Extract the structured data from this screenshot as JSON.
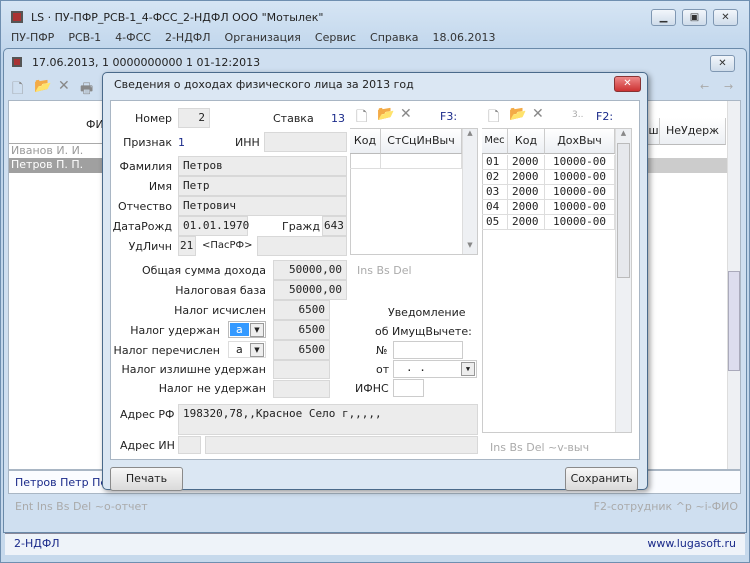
{
  "app": {
    "title": "LS · ПУ-ПФР_РСВ-1_4-ФСС_2-НДФЛ   ООО \"Мотылек\"",
    "menu": [
      "ПУ-ПФР",
      "РСВ-1",
      "4-ФСС",
      "2-НДФЛ",
      "Организация",
      "Сервис",
      "Справка",
      "18.06.2013"
    ]
  },
  "mdi": {
    "title": "17.06.2013, 1  0000000000  1  01-12:2013",
    "grid_header_fio": "ФИ",
    "columns_right": [
      "ш",
      "НеУдерж"
    ],
    "rows": [
      "Иванов И. И.",
      "Петров П. П."
    ],
    "footer_name": "Петров Петр Пе",
    "status_left": "Ent  Ins Bs Del  ~o-отчет",
    "status_right": "F2-сотрудник   ^p  ~i-ФИО",
    "bottom_left": "2-НДФЛ",
    "bottom_right": "www.lugasoft.ru"
  },
  "dialog": {
    "title": "Сведения о доходах физического лица за 2013 год",
    "nomer_label": "Номер",
    "nomer": "2",
    "stavka_label": "Ставка",
    "stavka": "13",
    "priznak_label": "Признак",
    "priznak": "1",
    "inn_label": "ИНН",
    "inn": "",
    "familia_label": "Фамилия",
    "familia": "Петров",
    "imya_label": "Имя",
    "imya": "Петр",
    "otchestvo_label": "Отчество",
    "otchestvo": "Петрович",
    "dob_label": "ДатаРожд",
    "dob": "01.01.1970",
    "grazhd_label": "Гражд",
    "grazhd": "643",
    "udl_label": "УдЛичн",
    "udl": "21",
    "udl_type": "<ПасРФ>",
    "udl_num": "",
    "total_label": "Общая сумма дохода",
    "total": "50000,00",
    "hint1": "Ins Bs Del",
    "base_label": "Налоговая база",
    "base": "50000,00",
    "calc_label": "Налог исчислен",
    "calc": "6500",
    "held_label": "Налог удержан",
    "held_code": "a",
    "held": "6500",
    "paid_label": "Налог перечислен",
    "paid_code": "a",
    "paid": "6500",
    "over_label": "Налог излишне удержан",
    "over": "",
    "notheld_label": "Налог не удержан",
    "notheld": "",
    "notice_label1": "Уведомление",
    "notice_label2": "об ИмущВычете:",
    "num_label": "№",
    "num": "",
    "from_label": "от",
    "from": " .  . ",
    "ifns_label": "ИФНС",
    "ifns": "",
    "addr_rf_label": "Адрес РФ",
    "addr_rf": "198320,78,,Красное Село г,,,,,",
    "addr_in_label": "Адрес ИН",
    "f3": "F3:",
    "f2": "F2:",
    "f2_more": "3..",
    "ded_table": {
      "columns": [
        "Код",
        "СтСцИнВыч"
      ]
    },
    "income_table": {
      "columns": [
        "Мес",
        "Код",
        "ДохВыч"
      ],
      "rows": [
        [
          "01",
          "2000",
          "10000-00"
        ],
        [
          "02",
          "2000",
          "10000-00"
        ],
        [
          "03",
          "2000",
          "10000-00"
        ],
        [
          "04",
          "2000",
          "10000-00"
        ],
        [
          "05",
          "2000",
          "10000-00"
        ]
      ]
    },
    "hint2": "Ins Bs Del  ~v-выч",
    "print": "Печать",
    "save": "Сохранить"
  }
}
